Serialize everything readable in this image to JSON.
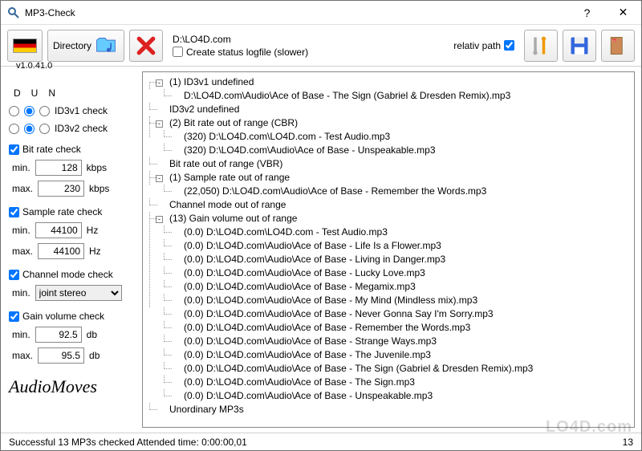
{
  "window": {
    "title": "MP3-Check"
  },
  "version": "v1.0.41.0",
  "toolbar": {
    "directory_label": "Directory",
    "path": "D:\\LO4D.com",
    "logfile_label": "Create status logfile (slower)",
    "relpath_label": "relativ path"
  },
  "sidebar": {
    "hdr_d": "D",
    "hdr_u": "U",
    "hdr_n": "N",
    "id3v1_label": "ID3v1 check",
    "id3v2_label": "ID3v2 check",
    "bitrate": {
      "label": "Bit rate check",
      "min_label": "min.",
      "min_value": "128",
      "min_unit": "kbps",
      "max_label": "max.",
      "max_value": "230",
      "max_unit": "kbps"
    },
    "samplerate": {
      "label": "Sample rate check",
      "min_label": "min.",
      "min_value": "44100",
      "min_unit": "Hz",
      "max_label": "max.",
      "max_value": "44100",
      "max_unit": "Hz"
    },
    "channel": {
      "label": "Channel mode check",
      "min_label": "min.",
      "value": "joint stereo"
    },
    "gain": {
      "label": "Gain volume check",
      "min_label": "min.",
      "min_value": "92.5",
      "min_unit": "db",
      "max_label": "max.",
      "max_value": "95.5",
      "max_unit": "db"
    },
    "logo": "AudioMoves"
  },
  "tree": {
    "n0": "(1) ID3v1 undefined",
    "n0_0": "D:\\LO4D.com\\Audio\\Ace of Base - The Sign (Gabriel & Dresden Remix).mp3",
    "n1": "ID3v2 undefined",
    "n2": "(2) Bit rate out of range (CBR)",
    "n2_0": "(320) D:\\LO4D.com\\LO4D.com - Test Audio.mp3",
    "n2_1": "(320) D:\\LO4D.com\\Audio\\Ace of Base - Unspeakable.mp3",
    "n3": "Bit rate out of range (VBR)",
    "n4": "(1) Sample rate out of range",
    "n4_0": "(22,050) D:\\LO4D.com\\Audio\\Ace of Base - Remember the Words.mp3",
    "n5": "Channel mode out of range",
    "n6": "(13) Gain volume out of range",
    "n6_0": "(0.0) D:\\LO4D.com\\LO4D.com - Test Audio.mp3",
    "n6_1": "(0.0) D:\\LO4D.com\\Audio\\Ace of Base - Life Is a Flower.mp3",
    "n6_2": "(0.0) D:\\LO4D.com\\Audio\\Ace of Base - Living in Danger.mp3",
    "n6_3": "(0.0) D:\\LO4D.com\\Audio\\Ace of Base - Lucky Love.mp3",
    "n6_4": "(0.0) D:\\LO4D.com\\Audio\\Ace of Base - Megamix.mp3",
    "n6_5": "(0.0) D:\\LO4D.com\\Audio\\Ace of Base - My Mind (Mindless mix).mp3",
    "n6_6": "(0.0) D:\\LO4D.com\\Audio\\Ace of Base - Never Gonna Say I'm Sorry.mp3",
    "n6_7": "(0.0) D:\\LO4D.com\\Audio\\Ace of Base - Remember the Words.mp3",
    "n6_8": "(0.0) D:\\LO4D.com\\Audio\\Ace of Base - Strange Ways.mp3",
    "n6_9": "(0.0) D:\\LO4D.com\\Audio\\Ace of Base - The Juvenile.mp3",
    "n6_10": "(0.0) D:\\LO4D.com\\Audio\\Ace of Base - The Sign (Gabriel & Dresden Remix).mp3",
    "n6_11": "(0.0) D:\\LO4D.com\\Audio\\Ace of Base - The Sign.mp3",
    "n6_12": "(0.0) D:\\LO4D.com\\Audio\\Ace of Base - Unspeakable.mp3",
    "n7": "Unordinary MP3s"
  },
  "status": {
    "text": "Successful 13 MP3s checked Attended time: 0:00:00,01",
    "count": "13"
  },
  "watermark": "LO4D.com"
}
